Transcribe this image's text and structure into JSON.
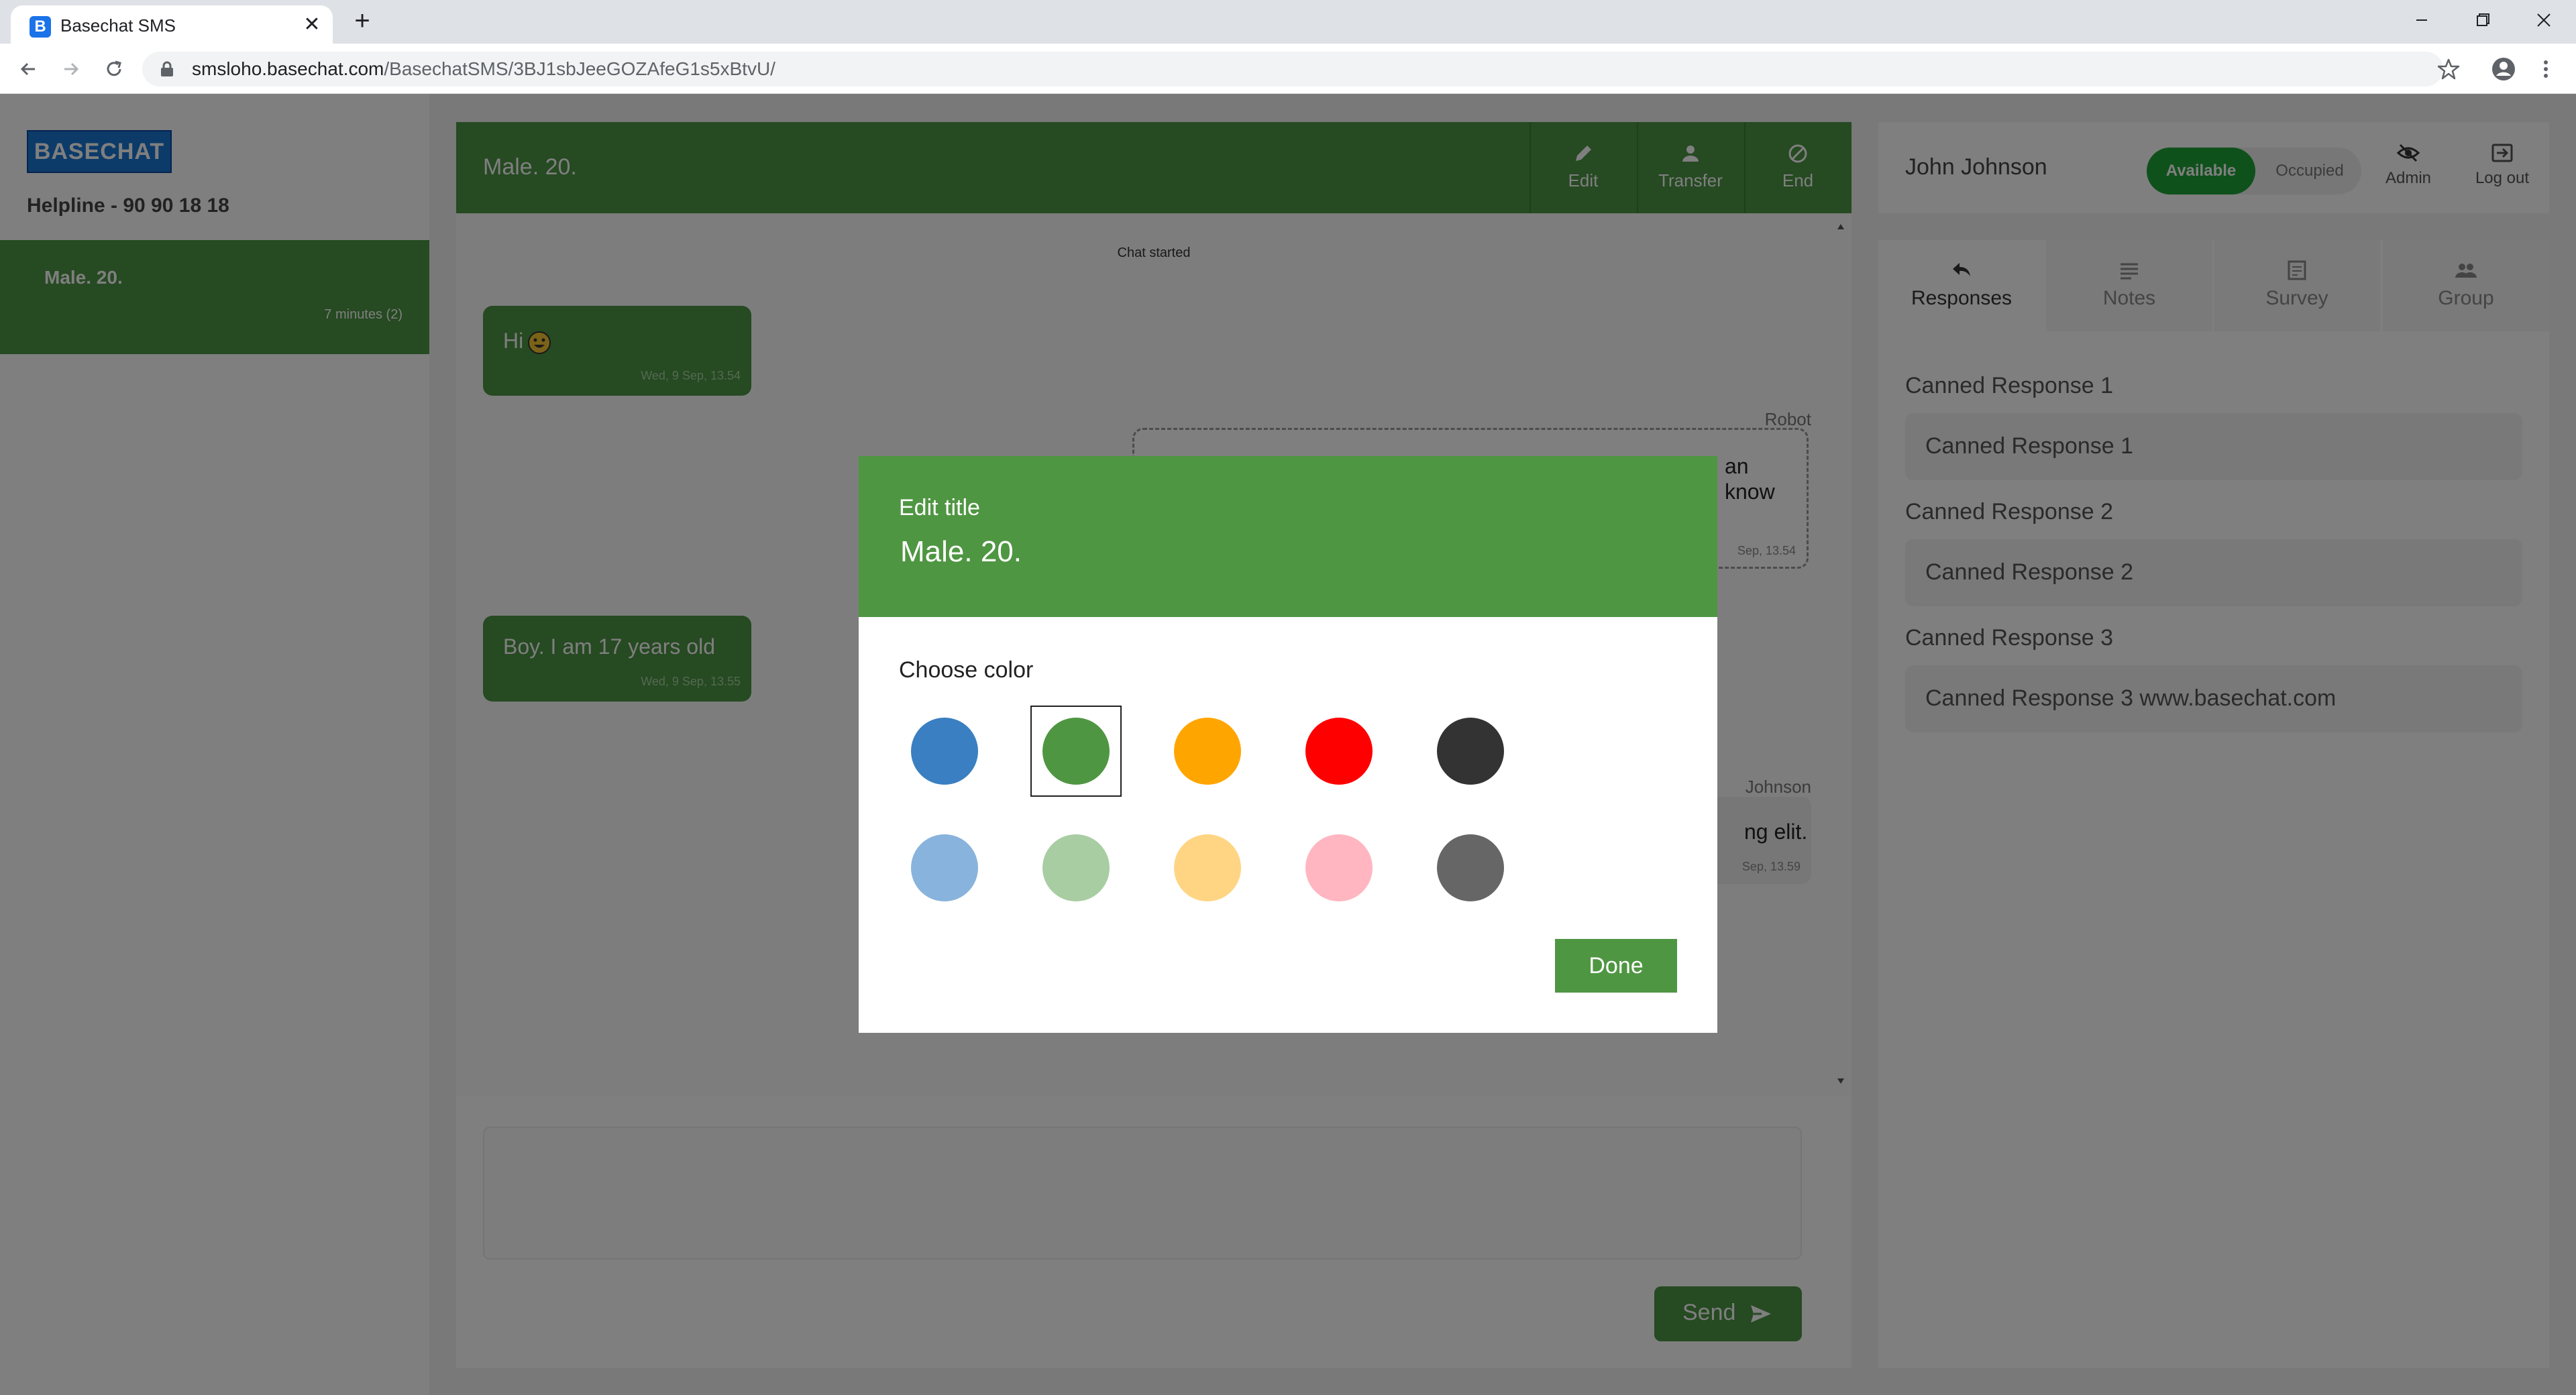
{
  "browser": {
    "tab_title": "Basechat SMS",
    "favicon_letter": "B",
    "tab_close": "✕",
    "new_tab": "+",
    "url_host": "smsloho.basechat.com",
    "url_path": "/BasechatSMS/3BJ1sbJeeGOZAfeG1s5xBtvU/"
  },
  "sidebar": {
    "logo": "BASECHAT",
    "helpline": "Helpline - 90 90 18 18",
    "chats": [
      {
        "title": "Male. 20.",
        "meta": "7 minutes (2)"
      }
    ]
  },
  "chat": {
    "title": "Male. 20.",
    "actions": {
      "edit": "Edit",
      "transfer": "Transfer",
      "end": "End"
    },
    "started": "Chat started",
    "messages": [
      {
        "text": "Hi",
        "time": "Wed, 9 Sep, 13.54"
      },
      {
        "author": "Robot",
        "line1": "an",
        "line2": "know",
        "time": "Sep, 13.54"
      },
      {
        "text": "Boy. I am 17 years old",
        "time": "Wed, 9 Sep, 13.55"
      },
      {
        "author": "Johnson",
        "text": "ng elit.",
        "time": "Sep, 13.59"
      }
    ],
    "send_label": "Send"
  },
  "agent": {
    "name": "John Johnson",
    "status_available": "Available",
    "status_occupied": "Occupied",
    "admin": "Admin",
    "logout": "Log out"
  },
  "right_tabs": [
    {
      "label": "Responses",
      "icon": "reply-icon"
    },
    {
      "label": "Notes",
      "icon": "notes-icon"
    },
    {
      "label": "Survey",
      "icon": "survey-icon"
    },
    {
      "label": "Group",
      "icon": "group-icon"
    }
  ],
  "canned_responses": [
    {
      "label": "Canned Response 1",
      "text": "Canned Response 1"
    },
    {
      "label": "Canned Response 2",
      "text": "Canned Response 2"
    },
    {
      "label": "Canned Response 3",
      "text": "Canned Response 3 www.basechat.com"
    }
  ],
  "modal": {
    "label": "Edit title",
    "title": "Male. 20.",
    "choose_color": "Choose color",
    "colors": [
      "#3a7fc1",
      "#4f9642",
      "#ffa500",
      "#ff0000",
      "#333333",
      "#88b3dc",
      "#a8cda2",
      "#ffd584",
      "#ffb6c1",
      "#666666"
    ],
    "selected_color": "#4f9642",
    "done": "Done"
  }
}
